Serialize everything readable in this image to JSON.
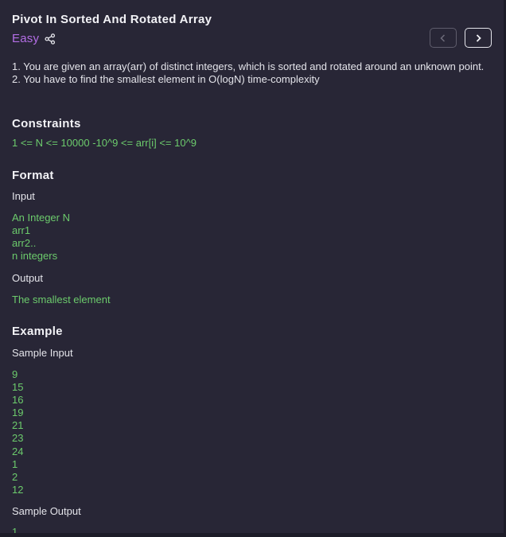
{
  "problem": {
    "title": "Pivot In Sorted And Rotated Array",
    "difficulty": "Easy",
    "description": [
      "1. You are given an array(arr) of distinct integers, which is sorted and rotated around an unknown point.",
      "2. You have to find the smallest element in O(logN) time-complexity"
    ]
  },
  "constraints": {
    "heading": "Constraints",
    "text": "1 <= N <= 10000 -10^9 <= arr[i] <= 10^9"
  },
  "format": {
    "heading": "Format",
    "input_label": "Input",
    "input_lines": [
      "An Integer N",
      "arr1",
      "arr2..",
      "n integers"
    ],
    "output_label": "Output",
    "output_text": "The smallest element"
  },
  "example": {
    "heading": "Example",
    "sample_input_label": "Sample Input",
    "sample_input": [
      "9",
      "15",
      "16",
      "19",
      "21",
      "23",
      "24",
      "1",
      "2",
      "12"
    ],
    "sample_output_label": "Sample Output",
    "sample_output": "1"
  },
  "icons": {
    "share": "share-icon",
    "prev": "chevron-left-icon",
    "next": "chevron-right-icon"
  },
  "colors": {
    "background": "#282636",
    "difficulty_easy": "#b46ee6",
    "code_text": "#6ccb6c"
  }
}
